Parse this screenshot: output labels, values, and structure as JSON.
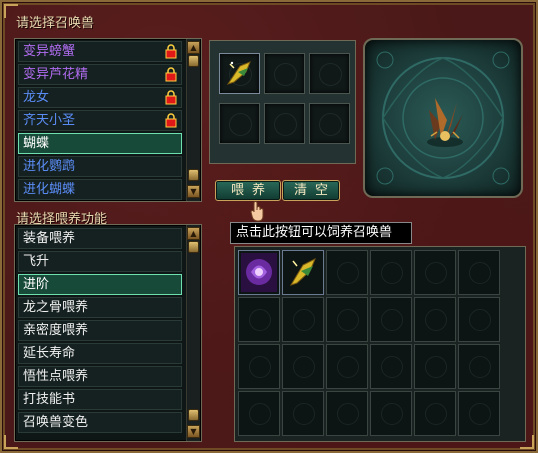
{
  "pet_section": {
    "title": "请选择召唤兽",
    "pets": [
      {
        "name": "变异螃蟹",
        "color": "purple",
        "locked": true
      },
      {
        "name": "变异芦花精",
        "color": "purple",
        "locked": true
      },
      {
        "name": "龙女",
        "color": "blue",
        "locked": true
      },
      {
        "name": "齐天小圣",
        "color": "blue",
        "locked": true
      },
      {
        "name": "蝴蝶",
        "color": "white",
        "locked": false,
        "selected": true
      },
      {
        "name": "进化鹦鹉",
        "color": "blue",
        "locked": false
      },
      {
        "name": "进化蝴蝶",
        "color": "blue",
        "locked": false
      }
    ]
  },
  "function_section": {
    "title": "请选择喂养功能",
    "items": [
      {
        "name": "装备喂养"
      },
      {
        "name": "飞升"
      },
      {
        "name": "进阶",
        "selected": true
      },
      {
        "name": "龙之骨喂养"
      },
      {
        "name": "亲密度喂养"
      },
      {
        "name": "延长寿命"
      },
      {
        "name": "悟性点喂养"
      },
      {
        "name": "打技能书"
      },
      {
        "name": "召唤兽变色"
      }
    ]
  },
  "buttons": {
    "feed_label": "喂养",
    "clear_label": "清空"
  },
  "tooltip": {
    "text": "点击此按钮可以饲养召唤兽"
  },
  "icons": {
    "lock": "lock-icon",
    "scroll_up": "arrow-up-icon",
    "scroll_down": "arrow-down-icon"
  },
  "colors": {
    "purple_text": "#b06cf0",
    "blue_text": "#5a8cf5",
    "selected_border": "#6ee0b0",
    "frame_gold": "#c9a35a"
  }
}
